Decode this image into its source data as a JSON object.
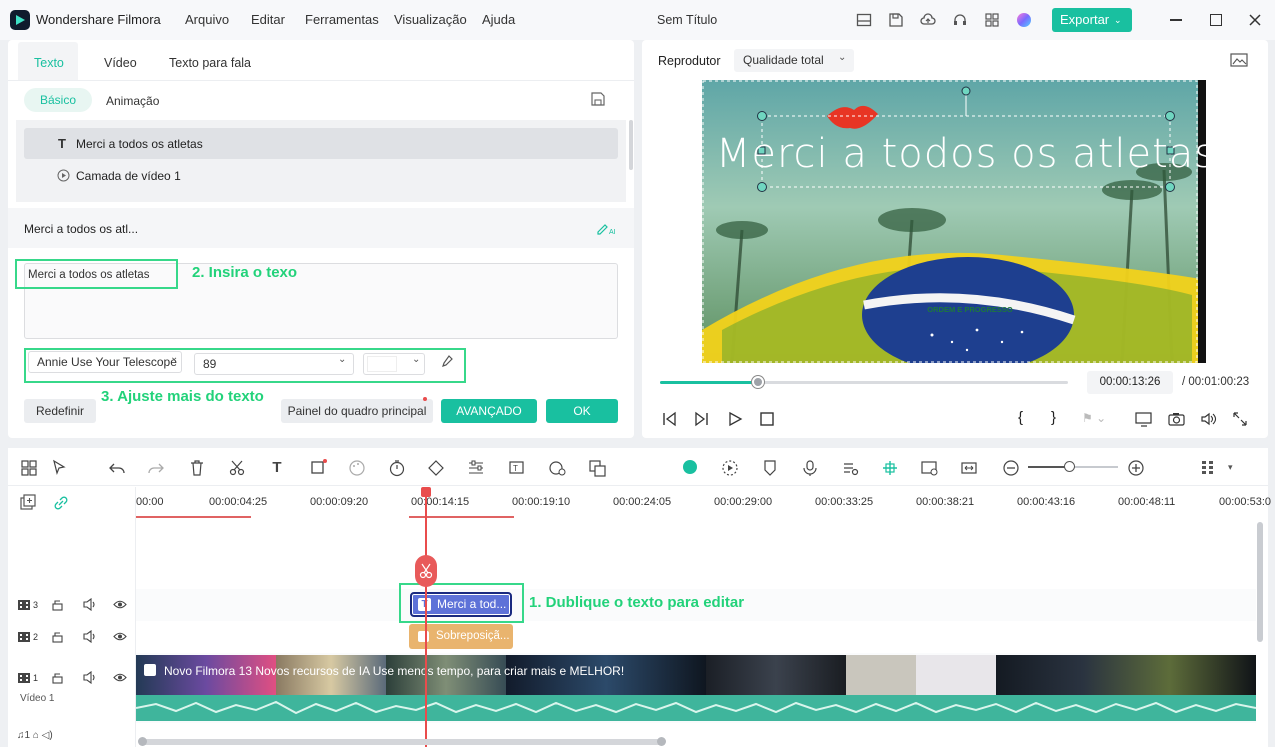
{
  "app": {
    "name": "Wondershare Filmora",
    "project_title": "Sem Título",
    "menu": [
      "Arquivo",
      "Editar",
      "Ferramentas",
      "Visualização",
      "Ajuda"
    ],
    "export_label": "Exportar",
    "accent_color": "#19c0a0"
  },
  "left_panel": {
    "tabs": [
      "Texto",
      "Vídeo",
      "Texto para fala"
    ],
    "active_tab": "Texto",
    "subtabs": [
      "Básico",
      "Animação"
    ],
    "active_subtab": "Básico",
    "layers": [
      {
        "label": "Merci a todos os atletas",
        "icon": "text-icon",
        "selected": true
      },
      {
        "label": "Camada de vídeo 1",
        "icon": "play-circle-icon",
        "selected": false
      }
    ],
    "section_title": "Merci a todos os atl...",
    "text_value": "Merci a todos os atletas",
    "font_family": "Annie Use Your Telescope",
    "font_size": "89",
    "buttons": {
      "reset": "Redefinir",
      "main_panel": "Painel do quadro principal",
      "advanced": "AVANÇADO",
      "ok": "OK"
    }
  },
  "annotations": {
    "step1": "1. Dublique o texto para editar",
    "step2": "2. Insira o texo",
    "step3": "3. Ajuste mais do texto"
  },
  "player": {
    "label": "Reprodutor",
    "quality": "Qualidade total",
    "overlay_text": "Merci a todos os atletas",
    "flag_motto": "ORDEM E PROGRESSO",
    "current_time": "00:00:13:26",
    "total_time": "/ 00:01:00:23",
    "progress": 0.24
  },
  "timeline": {
    "ruler": [
      "00:00",
      "00:00:04:25",
      "00:00:09:20",
      "00:00:14:15",
      "00:00:19:10",
      "00:00:24:05",
      "00:00:29:00",
      "00:00:33:25",
      "00:00:38:21",
      "00:00:43:16",
      "00:00:48:11",
      "00:00:53:0"
    ],
    "tracks": [
      {
        "number": "3"
      },
      {
        "number": "2"
      },
      {
        "number": "1",
        "label": "Vídeo 1"
      }
    ],
    "text_clip": "Merci a tod...",
    "overlay_clip": "Sobreposiçã...",
    "video_clip": "Novo Filmora 13 Novos recursos de IA  Use menos tempo, para criar mais e MELHOR!"
  }
}
